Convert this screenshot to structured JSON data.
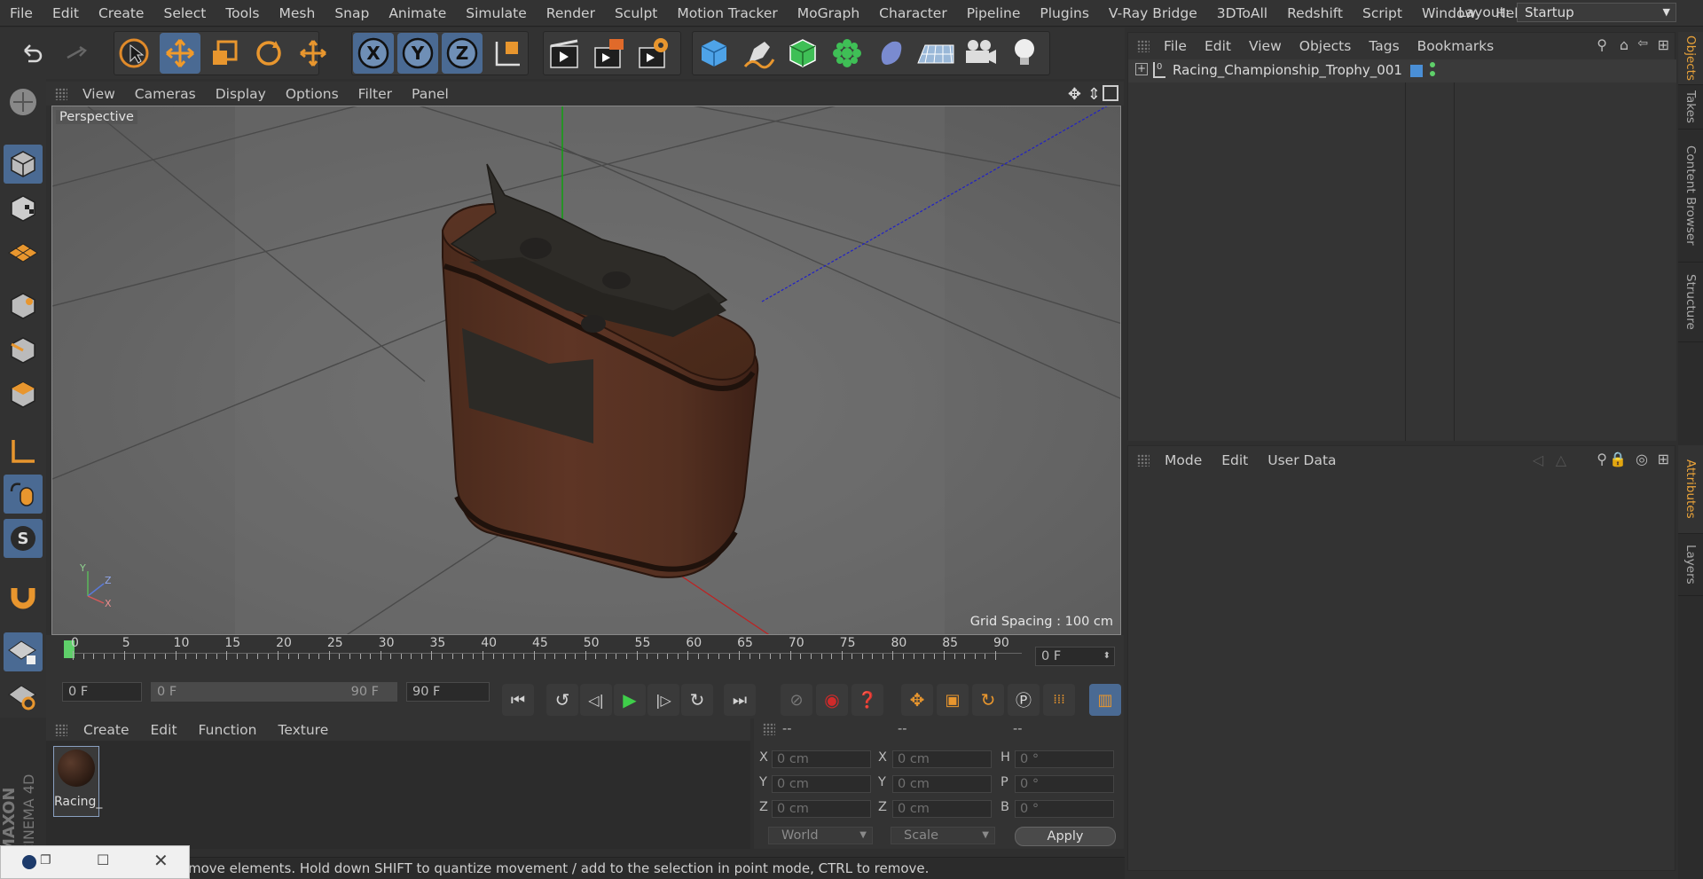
{
  "menubar": {
    "items": [
      "File",
      "Edit",
      "Create",
      "Select",
      "Tools",
      "Mesh",
      "Snap",
      "Animate",
      "Simulate",
      "Render",
      "Sculpt",
      "Motion Tracker",
      "MoGraph",
      "Character",
      "Pipeline",
      "Plugins",
      "V-Ray Bridge",
      "3DToAll",
      "Redshift",
      "Script",
      "Window",
      "Help"
    ],
    "layout_label": "Layout:",
    "layout_value": "Startup"
  },
  "toolbar": {
    "icons": [
      "undo-icon",
      "redo-icon",
      "live-selection-icon",
      "move-icon",
      "scale-icon",
      "rotate-icon",
      "recent-tool-icon",
      "x-axis-icon",
      "y-axis-icon",
      "z-axis-icon",
      "coordinate-system-icon",
      "render-view-icon",
      "render-picture-viewer-icon",
      "render-settings-icon",
      "cube-icon",
      "pen-icon",
      "subdivision-icon",
      "cloner-icon",
      "deformer-icon",
      "floor-icon",
      "camera-icon",
      "light-icon"
    ],
    "x_label": "X",
    "y_label": "Y",
    "z_label": "Z"
  },
  "viewport": {
    "menu": [
      "View",
      "Cameras",
      "Display",
      "Options",
      "Filter",
      "Panel"
    ],
    "camera_label": "Perspective",
    "grid_spacing": "Grid Spacing : 100 cm",
    "axis_y": "Y",
    "axis_z": "Z",
    "axis_x": "X"
  },
  "timeline": {
    "ticks": [
      "0",
      "5",
      "10",
      "15",
      "20",
      "25",
      "30",
      "35",
      "40",
      "45",
      "50",
      "55",
      "60",
      "65",
      "70",
      "75",
      "80",
      "85",
      "90"
    ],
    "current_frame": "0 F"
  },
  "transport": {
    "start_frame": "0 F",
    "range_start": "0 F",
    "range_end": "90 F",
    "end_frame": "90 F"
  },
  "material_panel": {
    "menu": [
      "Create",
      "Edit",
      "Function",
      "Texture"
    ],
    "material_name": "Racing_"
  },
  "coordinates": {
    "header": [
      "--",
      "--",
      "--"
    ],
    "rows": [
      {
        "l1": "X",
        "v1": "0 cm",
        "l2": "X",
        "v2": "0 cm",
        "l3": "H",
        "v3": "0 °"
      },
      {
        "l1": "Y",
        "v1": "0 cm",
        "l2": "Y",
        "v2": "0 cm",
        "l3": "P",
        "v3": "0 °"
      },
      {
        "l1": "Z",
        "v1": "0 cm",
        "l2": "Z",
        "v2": "0 cm",
        "l3": "B",
        "v3": "0 °"
      }
    ],
    "mode_world": "World",
    "mode_scale": "Scale",
    "apply": "Apply"
  },
  "status": {
    "text": "move elements. Hold down SHIFT to quantize movement / add to the selection in point mode, CTRL to remove."
  },
  "objects_panel": {
    "menu": [
      "File",
      "Edit",
      "View",
      "Objects",
      "Tags",
      "Bookmarks"
    ],
    "object_name": "Racing_Championship_Trophy_001",
    "tag_color": "#4a8fd6"
  },
  "attributes_panel": {
    "menu": [
      "Mode",
      "Edit",
      "User Data"
    ]
  },
  "side_tabs": [
    "Objects",
    "Takes",
    "Content Browser",
    "Structure",
    "Attributes",
    "Layers"
  ],
  "brand": {
    "line1": "MAXON",
    "line2": "CINEMA 4D"
  }
}
